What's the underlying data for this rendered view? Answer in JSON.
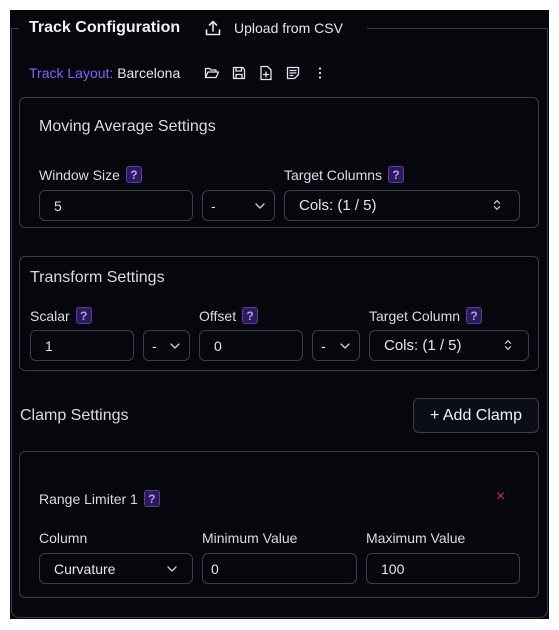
{
  "header": {
    "title": "Track Configuration",
    "upload_label": "Upload from CSV"
  },
  "track_layout": {
    "label": "Track Layout:",
    "value": "Barcelona"
  },
  "moving_average": {
    "title": "Moving Average Settings",
    "window_label": "Window Size",
    "window_value": "5",
    "op_value": "-",
    "target_label": "Target Columns",
    "target_value": "Cols: (1 / 5)"
  },
  "transform": {
    "title": "Transform Settings",
    "scalar_label": "Scalar",
    "scalar_value": "1",
    "scalar_op": "-",
    "offset_label": "Offset",
    "offset_value": "0",
    "offset_op": "-",
    "target_label": "Target Column",
    "target_value": "Cols: (1 / 5)"
  },
  "clamp": {
    "title": "Clamp Settings",
    "add_label": "+ Add Clamp",
    "limiter": {
      "title": "Range Limiter 1",
      "close_glyph": "×",
      "column_label": "Column",
      "column_value": "Curvature",
      "min_label": "Minimum Value",
      "min_value": "0",
      "max_label": "Maximum Value",
      "max_value": "100"
    }
  },
  "help_glyph": "?",
  "colors": {
    "background": "#05070d",
    "border": "#3a3f4b",
    "accent_purple": "#8b5cf6",
    "help_bg": "#2c1a5a",
    "close_red": "#c0392b"
  },
  "icons": [
    "upload-icon",
    "folder-open-icon",
    "save-icon",
    "new-file-icon",
    "notes-icon",
    "more-vertical-icon",
    "chevron-down-icon",
    "chevron-updown-icon",
    "close-icon"
  ]
}
